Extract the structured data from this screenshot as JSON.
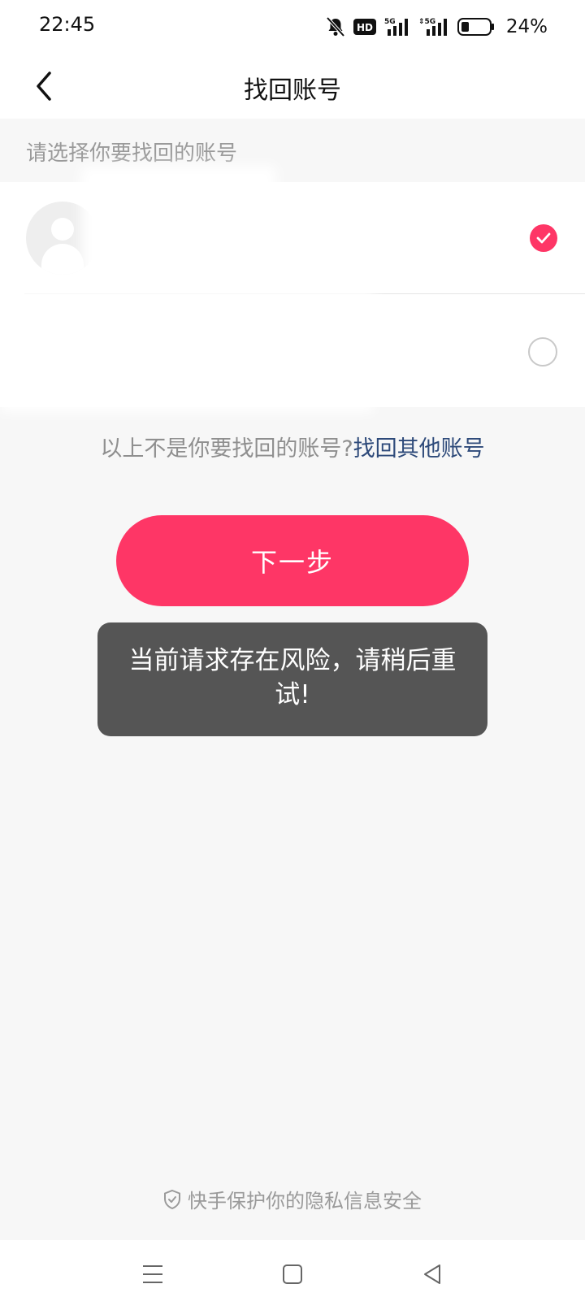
{
  "status_bar": {
    "time": "22:45",
    "icons": [
      "bell-muted-icon",
      "hd-icon",
      "signal-5g-icon",
      "signal-5g-2-icon",
      "battery-icon"
    ],
    "battery_percent": "24%"
  },
  "nav": {
    "back_icon": "chevron-left-icon",
    "title": "找回账号"
  },
  "section_hint": "请选择你要找回的账号",
  "accounts": [
    {
      "avatar_icon": "default-avatar-icon",
      "selected": true
    },
    {
      "selected": false
    }
  ],
  "other_prompt": {
    "text": "以上不是你要找回的账号?",
    "link": "找回其他账号"
  },
  "next_button": {
    "label": "下一步"
  },
  "toast": {
    "message": "当前请求存在风险，请稍后重试!"
  },
  "privacy": {
    "icon": "shield-check-icon",
    "text": "快手保护你的隐私信息安全"
  },
  "system_nav": {
    "icons": [
      "menu-icon",
      "home-square-icon",
      "back-triangle-icon"
    ]
  },
  "colors": {
    "accent": "#fe3666",
    "link": "#2e4a7a",
    "toast_bg": "#555555",
    "page_bg": "#f7f7f7"
  }
}
